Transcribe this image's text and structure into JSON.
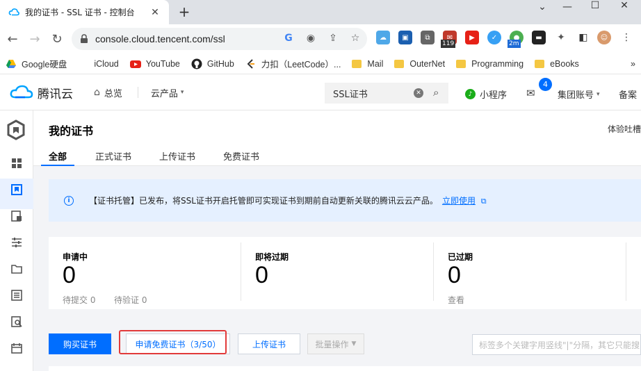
{
  "browser": {
    "tab_title": "我的证书 - SSL 证书 - 控制台",
    "url": "console.cloud.tencent.com/ssl",
    "extension_badges": {
      "mail": "119",
      "timer": "2m"
    },
    "bookmarks": [
      {
        "label": "Google硬盘",
        "icon": "google-drive-icon"
      },
      {
        "label": "iCloud",
        "icon": "apple-icon"
      },
      {
        "label": "YouTube",
        "icon": "youtube-icon"
      },
      {
        "label": "GitHub",
        "icon": "github-icon"
      },
      {
        "label": "力扣（LeetCode）...",
        "icon": "leetcode-icon"
      },
      {
        "label": "Mail",
        "icon": "folder-icon"
      },
      {
        "label": "OuterNet",
        "icon": "folder-icon"
      },
      {
        "label": "Programming",
        "icon": "folder-icon"
      },
      {
        "label": "eBooks",
        "icon": "folder-icon"
      }
    ]
  },
  "topnav": {
    "brand": "腾讯云",
    "overview": "总览",
    "products": "云产品",
    "search_value": "SSL证书",
    "mini_program": "小程序",
    "mail_badge": "4",
    "account": "集团账号",
    "filing": "备案"
  },
  "page": {
    "title": "我的证书",
    "feedback": "体验吐槽",
    "tabs": [
      "全部",
      "正式证书",
      "上传证书",
      "免费证书"
    ],
    "active_tab": 0
  },
  "notice": {
    "text": "【证书托管】已发布，将SSL证书开启托管即可实现证书到期前自动更新关联的腾讯云云产品。",
    "link": "立即使用"
  },
  "stats": [
    {
      "label": "申请中",
      "value": "0",
      "subs": [
        "待提交 0",
        "待验证 0"
      ]
    },
    {
      "label": "即将过期",
      "value": "0",
      "subs": []
    },
    {
      "label": "已过期",
      "value": "0",
      "subs": [
        "查看"
      ]
    }
  ],
  "actions": {
    "buy": "购买证书",
    "apply_free": "申请免费证书（3/50）",
    "upload": "上传证书",
    "bulk": "批量操作",
    "search_placeholder": "标签多个关键字用竖线\"|\"分隔，其它只能搜"
  },
  "colors": {
    "accent": "#006eff",
    "highlight": "#e23a3a",
    "notice_bg": "#e5f0ff"
  }
}
